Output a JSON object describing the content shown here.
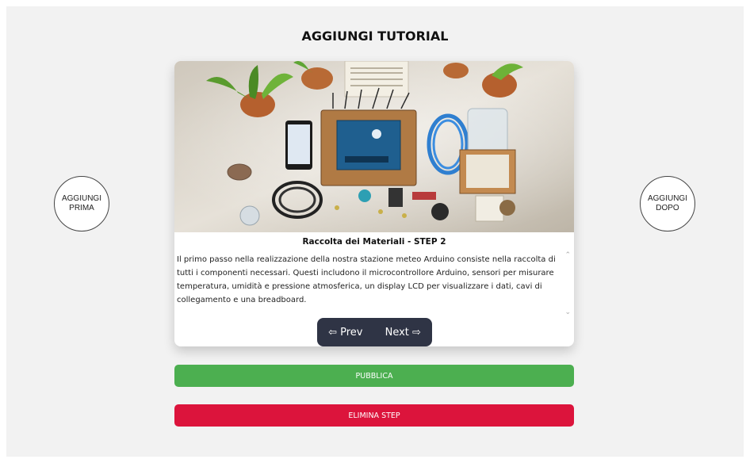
{
  "page": {
    "title": "AGGIUNGI TUTORIAL"
  },
  "side_buttons": {
    "before": {
      "line1": "AGGIUNGI",
      "line2": "PRIMA"
    },
    "after": {
      "line1": "AGGIUNGI",
      "line2": "DOPO"
    }
  },
  "step": {
    "title": "Raccolta dei Materiali - STEP 2",
    "text": "Il primo passo nella realizzazione della nostra stazione meteo Arduino consiste nella raccolta di tutti i componenti necessari. Questi includono il microcontrollore Arduino, sensori per misurare temperatura, umidità e pressione atmosferica, un display LCD per visualizzare i dati, cavi di collegamento e una breadboard."
  },
  "nav": {
    "prev": "⇦ Prev",
    "next": "Next ⇨"
  },
  "actions": {
    "publish": "PUBBLICA",
    "delete": "ELIMINA STEP"
  },
  "colors": {
    "publish": "#4caf50",
    "delete": "#dc143c",
    "nav_bg": "#2f3445"
  }
}
